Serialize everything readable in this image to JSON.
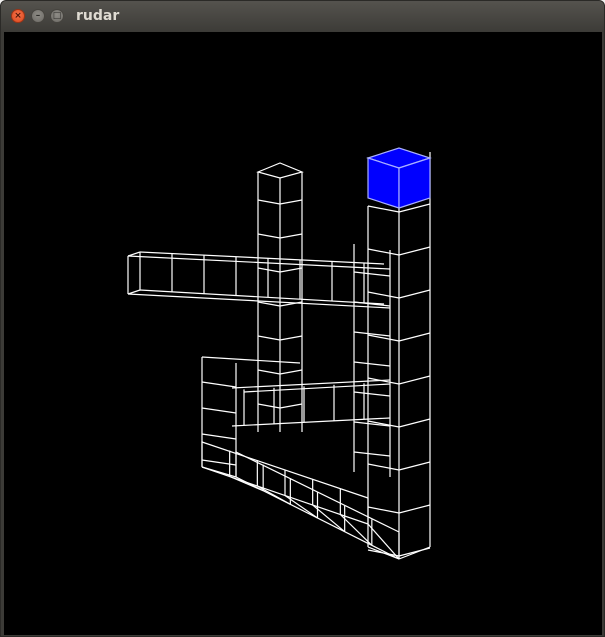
{
  "window": {
    "title": "rudar",
    "close_glyph": "×",
    "minimize_glyph": "–",
    "maximize_glyph": "□"
  },
  "colors": {
    "titlebar": "#3c3b37",
    "title_text": "#dfdbd2",
    "close_button": "#e95420",
    "canvas_background": "#000000",
    "wireframe": "#ffffff",
    "highlight_cube": "#0000ff"
  },
  "icons": {
    "close": "close-icon",
    "minimize": "minimize-icon",
    "maximize": "maximize-icon"
  }
}
